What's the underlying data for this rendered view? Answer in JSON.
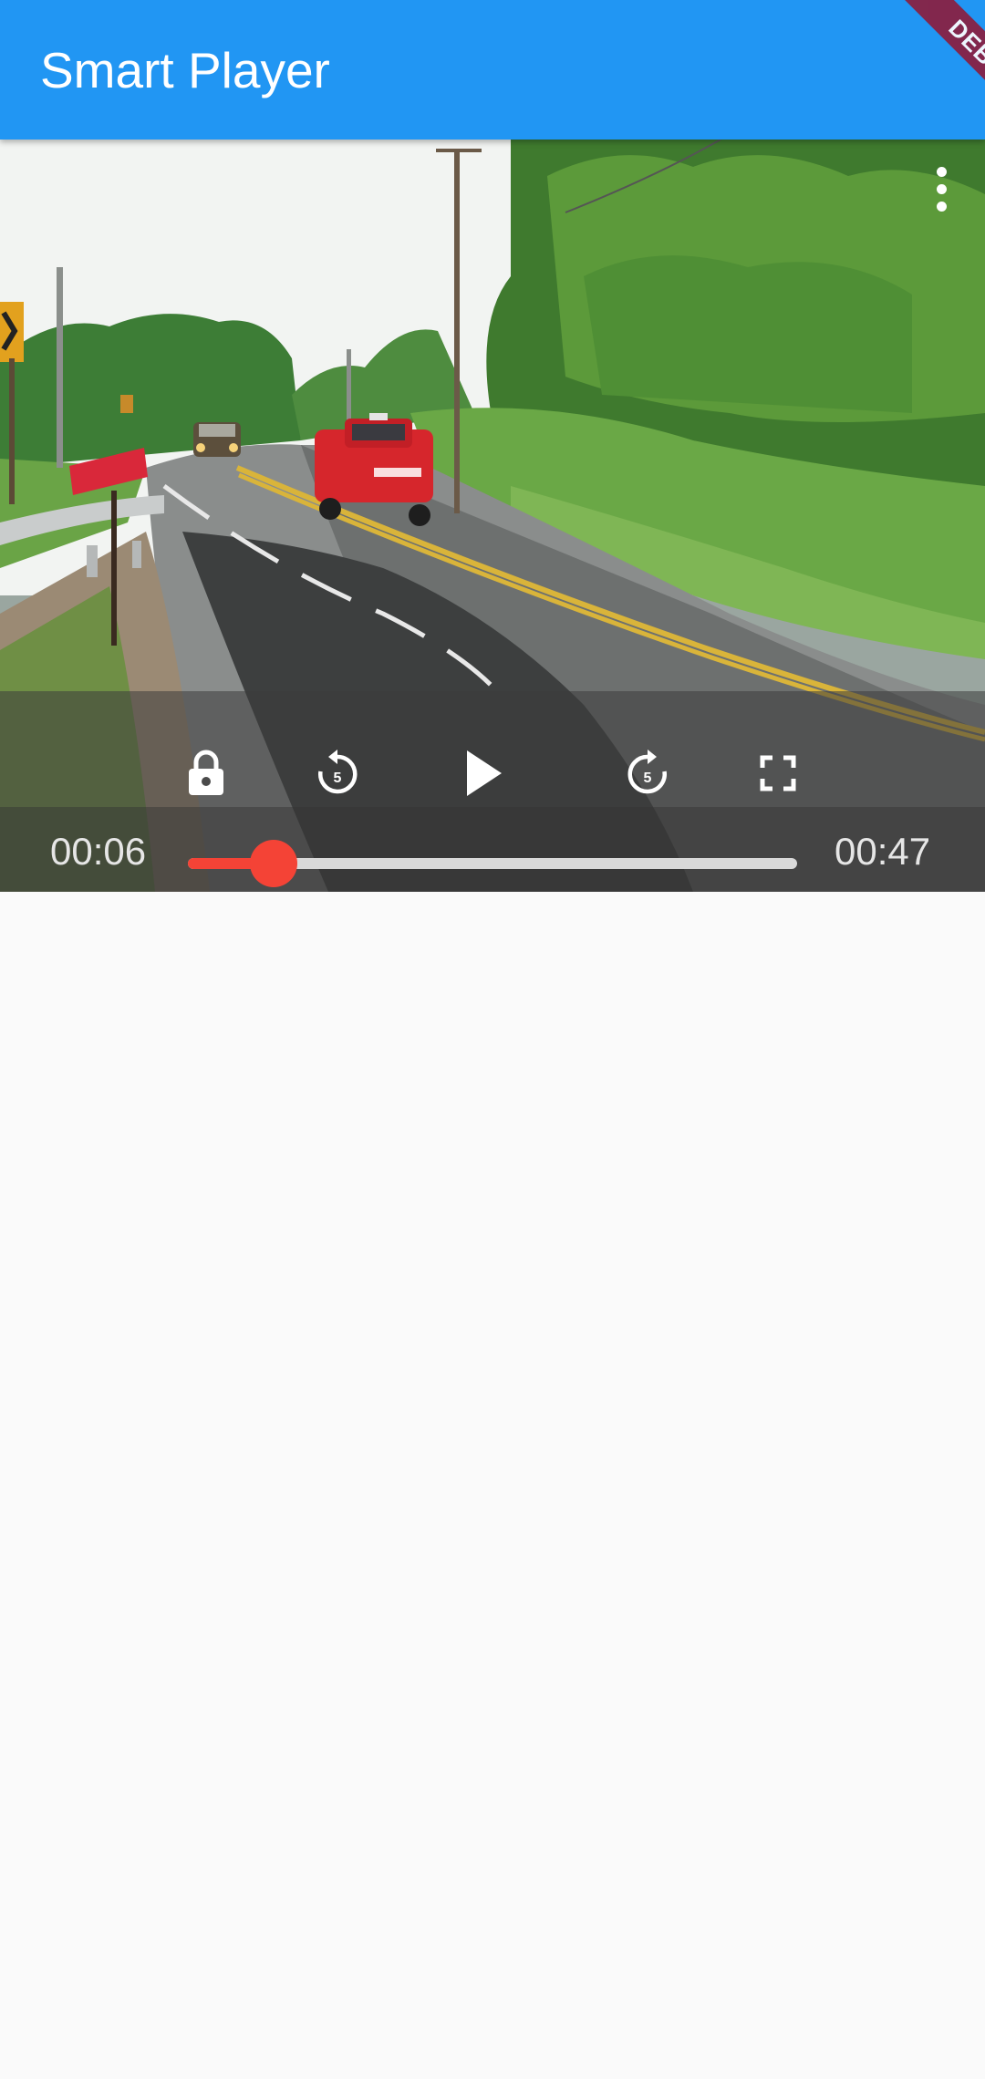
{
  "app_bar": {
    "title": "Smart Player",
    "color": "#2196f3"
  },
  "debug_banner": {
    "label": "DEBUG"
  },
  "player": {
    "current_time": "00:06",
    "total_time": "00:47",
    "progress": 0.14,
    "accent_color": "#f44336",
    "controls": {
      "lock": "lock-icon",
      "rewind": "replay-5-icon",
      "play": "play-icon",
      "forward": "forward-5-icon",
      "fullscreen": "fullscreen-icon",
      "more": "more-vert-icon"
    },
    "skip_seconds": "5"
  }
}
